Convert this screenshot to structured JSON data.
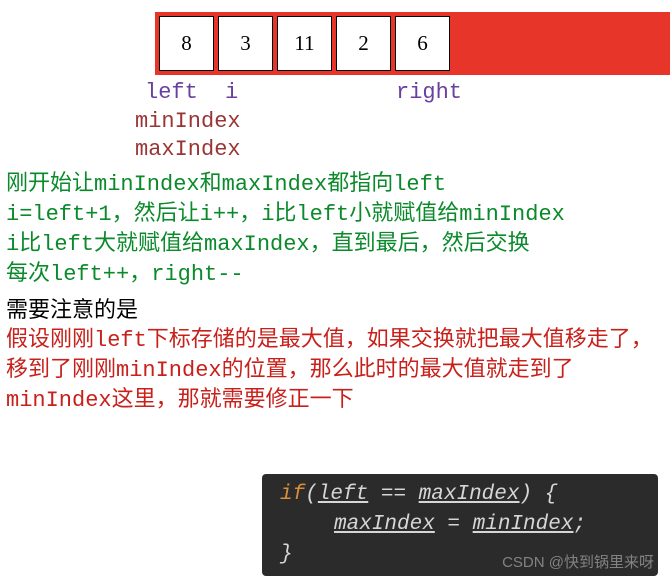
{
  "array": {
    "values": [
      "8",
      "3",
      "11",
      "2",
      "6"
    ]
  },
  "pointers": {
    "left": "left",
    "i": "i",
    "right": "right"
  },
  "vars": {
    "minIndex": "minIndex",
    "maxIndex": "maxIndex"
  },
  "explain": {
    "g1": "刚开始让minIndex和maxIndex都指向left",
    "g2": "i=left+1，然后让i++，i比left小就赋值给minIndex",
    "g3": "i比left大就赋值给maxIndex，直到最后，然后交换",
    "g4": "每次left++，right--",
    "note": "需要注意的是",
    "r1": "假设刚刚left下标存储的是最大值，如果交换就把最大值移走了，移到了刚刚minIndex的位置，那么此时的最大值就走到了minIndex这里，那就需要修正一下"
  },
  "code": {
    "if_kw": "if",
    "lparen": "(",
    "left_var": "left",
    "eq": " == ",
    "max_var": "maxIndex",
    "rparen_brace": ") {",
    "max_assign": "maxIndex",
    "eq2": " = ",
    "min_assign": "minIndex",
    "semi": ";",
    "close": "}"
  },
  "watermark": "CSDN @快到锅里来呀"
}
